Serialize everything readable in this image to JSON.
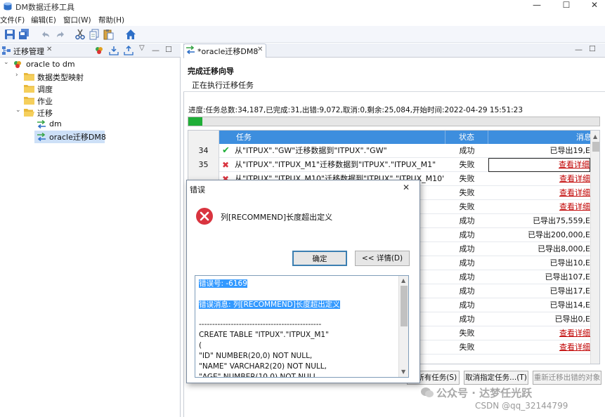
{
  "window": {
    "title": "DM数据迁移工具",
    "minimize": "—",
    "maximize": "☐",
    "close": "✕"
  },
  "menu": [
    {
      "label": "文件(F)"
    },
    {
      "label": "编辑(E)"
    },
    {
      "label": "窗口(W)"
    },
    {
      "label": "帮助(H)"
    }
  ],
  "left_view": {
    "tab_label": "迁移管理",
    "tree": {
      "root": "oracle to dm",
      "children": [
        "数据类型映射",
        "调度",
        "作业",
        "迁移"
      ],
      "migrations": [
        "dm",
        "oracle迁移DM8"
      ]
    }
  },
  "editor": {
    "tab_label": "*oracle迁移DM8",
    "heading": "完成迁移向导",
    "subheading": "正在执行迁移任务",
    "progress_text": "进度:任务总数:34,187,已完成:31,出错:9,072,取消:0,剩余:25,084,开始时间:2022-04-29 15:51:23",
    "progress_fraction": 0.035,
    "table": {
      "columns": [
        "任务",
        "状态",
        "消息"
      ],
      "rows": [
        {
          "num": "34",
          "ok": true,
          "task": "从\"ITPUX\".\"GW\"迁移数据到\"ITPUX\".\"GW\"",
          "status": "成功",
          "msg": "已导出19,E",
          "link": false
        },
        {
          "num": "35",
          "ok": false,
          "task": "从\"ITPUX\".\"ITPUX_M1\"迁移数据到\"ITPUX\".\"ITPUX_M1\"",
          "status": "失败",
          "msg": "查看详细",
          "link": true
        },
        {
          "num": "",
          "ok": false,
          "task": "从\"ITPUX\".\"ITPUX_M10\"迁移数据到\"ITPUX\".\"ITPUX_M10\"",
          "status": "失败",
          "msg": "查看详细",
          "link": true
        },
        {
          "num": "",
          "ok": false,
          "task": "S\"",
          "status": "失败",
          "msg": "查看详细",
          "link": true
        },
        {
          "num": "",
          "ok": false,
          "task": "ER\"",
          "status": "失败",
          "msg": "查看详细",
          "link": true
        },
        {
          "num": "",
          "ok": true,
          "task": "BJ\"",
          "status": "成功",
          "msg": "已导出75,559,E",
          "link": false
        },
        {
          "num": "",
          "ok": true,
          "task": "SALES\"",
          "status": "成功",
          "msg": "已导出200,000,E",
          "link": false
        },
        {
          "num": "",
          "ok": true,
          "task": "",
          "status": "成功",
          "msg": "已导出8,000,E",
          "link": false
        },
        {
          "num": "",
          "ok": true,
          "task": "",
          "status": "成功",
          "msg": "已导出10,E",
          "link": false
        },
        {
          "num": "",
          "ok": true,
          "task": "",
          "status": "成功",
          "msg": "已导出107,E",
          "link": false
        },
        {
          "num": "",
          "ok": true,
          "task": "ES\"",
          "status": "成功",
          "msg": "已导出17,E",
          "link": false
        },
        {
          "num": "",
          "ok": true,
          "task": "",
          "status": "成功",
          "msg": "已导出14,E",
          "link": false
        },
        {
          "num": "",
          "ok": true,
          "task": "LOB\"",
          "status": "成功",
          "msg": "已导出0,E",
          "link": false
        },
        {
          "num": "",
          "ok": false,
          "task": "",
          "status": "失败",
          "msg": "查看详细",
          "link": true
        },
        {
          "num": "",
          "ok": false,
          "task": "",
          "status": "失败",
          "msg": "查看详细",
          "link": true
        }
      ]
    },
    "buttons": {
      "cancel_all": "消所有任务(S)",
      "cancel_selected": "取消指定任务...(T)",
      "retry": "重新迁移出错的对象"
    }
  },
  "dialog": {
    "title": "错误",
    "message": "列[RECOMMEND]长度超出定义",
    "ok_button": "确定",
    "details_button": "<< 详情(D)",
    "detail_lines": [
      {
        "text": "错误号:   -6169",
        "selected": true
      },
      {
        "text": "",
        "selected": false
      },
      {
        "text": "错误消息: 列[RECOMMEND]长度超出定义",
        "selected": true
      },
      {
        "text": "",
        "selected": false
      },
      {
        "text": "----------------------------------------------",
        "selected": false
      },
      {
        "text": "CREATE TABLE \"ITPUX\".\"ITPUX_M1\"",
        "selected": false
      },
      {
        "text": "(",
        "selected": false
      },
      {
        "text": "\"ID\" NUMBER(20,0) NOT NULL,",
        "selected": false
      },
      {
        "text": "\"NAME\" VARCHAR2(20) NOT NULL,",
        "selected": false
      },
      {
        "text": "\"AGE\" NUMBER(10,0) NOT NULL",
        "selected": false
      }
    ]
  },
  "watermark": {
    "line1": "公众号 · 达梦任光跃",
    "line2": "CSDN @qq_32144799"
  },
  "colors": {
    "header_blue": "#3d8ede",
    "progress_green": "#1fae37",
    "error_red": "#d9343f",
    "link_red": "#c00000",
    "selection_blue": "#3399ff"
  }
}
